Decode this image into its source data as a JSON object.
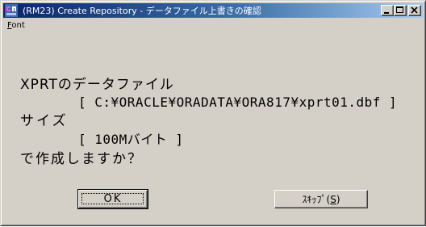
{
  "window": {
    "title": "(RM23) Create Repository  - データファイル上書きの確認"
  },
  "menu": {
    "items": [
      {
        "label_underlined": "F",
        "label_rest": "ont"
      }
    ]
  },
  "message": {
    "line1": "XPRTのデータファイル",
    "line2": "[ C:¥ORACLE¥ORADATA¥ORA817¥xprt01.dbf ]",
    "line3": "サイズ",
    "line4": "[ 100Mバイト ]",
    "line5": "で作成しますか？"
  },
  "buttons": {
    "ok_label": "OK",
    "skip_label": "ｽｷｯﾌﾟ(",
    "skip_mnemonic": "S",
    "skip_close": ")"
  },
  "titlebar_buttons": {
    "minimize": "minimize-icon",
    "maximize": "maximize-icon",
    "close": "close-icon"
  },
  "colors": {
    "title_start": "#0a246a",
    "title_end": "#a6caf0",
    "face": "#d4d0c8"
  }
}
